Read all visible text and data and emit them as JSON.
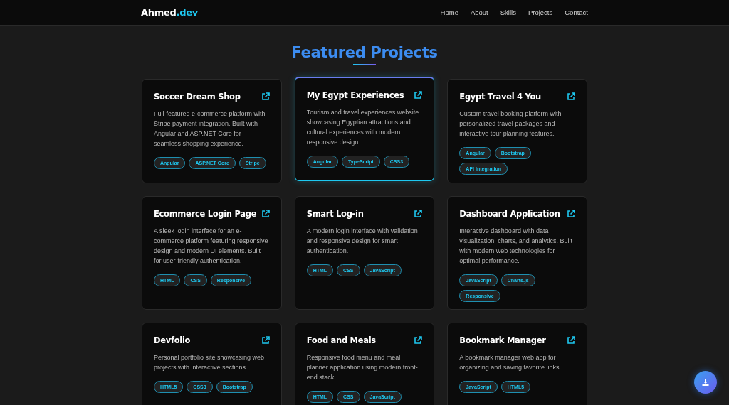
{
  "nav": {
    "logo": {
      "name": "Ahmed",
      "accent": ".dev"
    },
    "links": [
      "Home",
      "About",
      "Skills",
      "Projects",
      "Contact"
    ]
  },
  "section": {
    "title": "Featured Projects"
  },
  "projects": [
    {
      "title": "Soccer Dream Shop",
      "description": "Full-featured e-commerce platform with Stripe payment integration. Built with Angular and ASP.NET Core for seamless shopping experience.",
      "tags": [
        "Angular",
        "ASP.NET Core",
        "Stripe"
      ],
      "hovered": false
    },
    {
      "title": "My Egypt Experiences",
      "description": "Tourism and travel experiences website showcasing Egyptian attractions and cultural experiences with modern responsive design.",
      "tags": [
        "Angular",
        "TypeScript",
        "CSS3"
      ],
      "hovered": true
    },
    {
      "title": "Egypt Travel 4 You",
      "description": "Custom travel booking platform with personalized travel packages and interactive tour planning features.",
      "tags": [
        "Angular",
        "Bootstrap",
        "API Integration"
      ],
      "hovered": false
    },
    {
      "title": "Ecommerce Login Page",
      "description": "A sleek login interface for an e-commerce platform featuring responsive design and modern UI elements. Built for user-friendly authentication.",
      "tags": [
        "HTML",
        "CSS",
        "Responsive"
      ],
      "hovered": false
    },
    {
      "title": "Smart Log-in",
      "description": "A modern login interface with validation and responsive design for smart authentication.",
      "tags": [
        "HTML",
        "CSS",
        "JavaScript"
      ],
      "hovered": false
    },
    {
      "title": "Dashboard Application",
      "description": "Interactive dashboard with data visualization, charts, and analytics. Built with modern web technologies for optimal performance.",
      "tags": [
        "JavaScript",
        "Charts.js",
        "Responsive"
      ],
      "hovered": false
    },
    {
      "title": "Devfolio",
      "description": "Personal portfolio site showcasing web projects with interactive sections.",
      "tags": [
        "HTML5",
        "CSS3",
        "Bootstrap"
      ],
      "hovered": false
    },
    {
      "title": "Food and Meals",
      "description": "Responsive food menu and meal planner application using modern front-end stack.",
      "tags": [
        "HTML",
        "CSS",
        "JavaScript"
      ],
      "hovered": false
    },
    {
      "title": "Bookmark Manager",
      "description": "A bookmark manager web app for organizing and saving favorite links.",
      "tags": [
        "JavaScript",
        "HTML5"
      ],
      "hovered": false
    }
  ]
}
